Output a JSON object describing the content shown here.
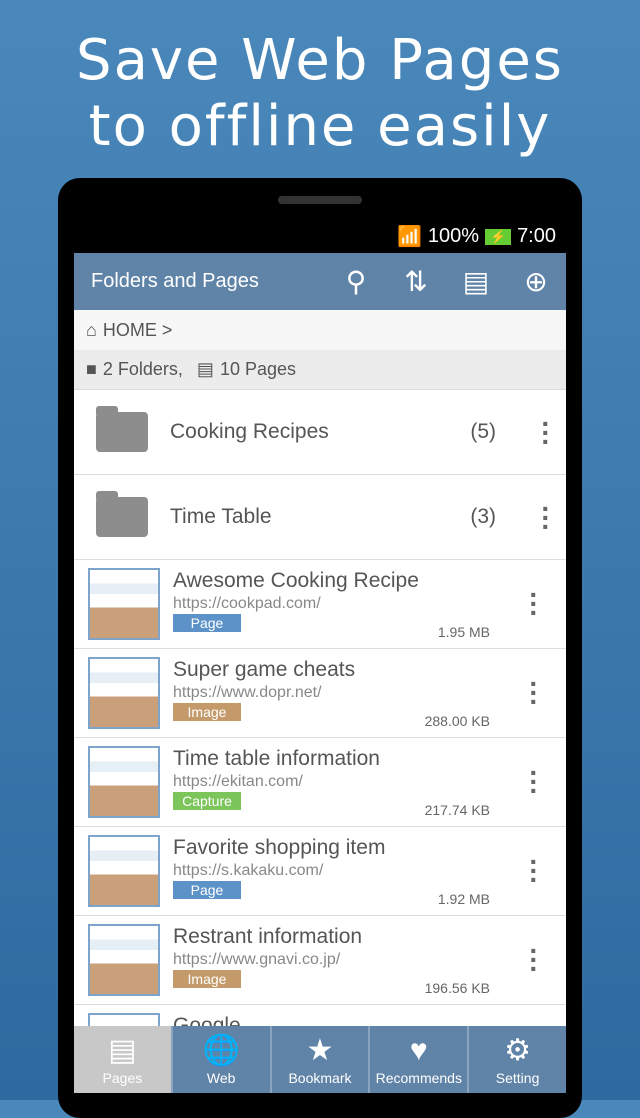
{
  "headline": [
    "Save Web Pages",
    "to offline easily"
  ],
  "status": {
    "battery": "100%",
    "time": "7:00"
  },
  "appbar": {
    "title": "Folders and Pages",
    "icons": [
      "search-icon",
      "sort-icon",
      "folder-list-icon",
      "add-folder-icon"
    ]
  },
  "breadcrumb": "HOME >",
  "summary": {
    "folders": "2 Folders,",
    "pages": "10 Pages"
  },
  "folders": [
    {
      "name": "Cooking Recipes",
      "count": "(5)"
    },
    {
      "name": "Time Table",
      "count": "(3)"
    }
  ],
  "pages": [
    {
      "title": "Awesome Cooking Recipe",
      "url": "https://cookpad.com/",
      "type": "Page",
      "size": "1.95 MB"
    },
    {
      "title": "Super game cheats",
      "url": "https://www.dopr.net/",
      "type": "Image",
      "size": "288.00 KB"
    },
    {
      "title": "Time table information",
      "url": "https://ekitan.com/",
      "type": "Capture",
      "size": "217.74 KB"
    },
    {
      "title": "Favorite shopping item",
      "url": "https://s.kakaku.com/",
      "type": "Page",
      "size": "1.92 MB"
    },
    {
      "title": "Restrant information",
      "url": "https://www.gnavi.co.jp/",
      "type": "Image",
      "size": "196.56 KB"
    },
    {
      "title": "Google",
      "url": "",
      "type": "",
      "size": ""
    }
  ],
  "badge_colors": {
    "Page": "#5d92c8",
    "Image": "#c49a6b",
    "Capture": "#7cc55b"
  },
  "nav": [
    {
      "label": "Pages",
      "icon": "pages-icon",
      "active": true
    },
    {
      "label": "Web",
      "icon": "globe-icon"
    },
    {
      "label": "Bookmark",
      "icon": "star-icon"
    },
    {
      "label": "Recommends",
      "icon": "heart-icon"
    },
    {
      "label": "Setting",
      "icon": "gear-icon"
    }
  ]
}
